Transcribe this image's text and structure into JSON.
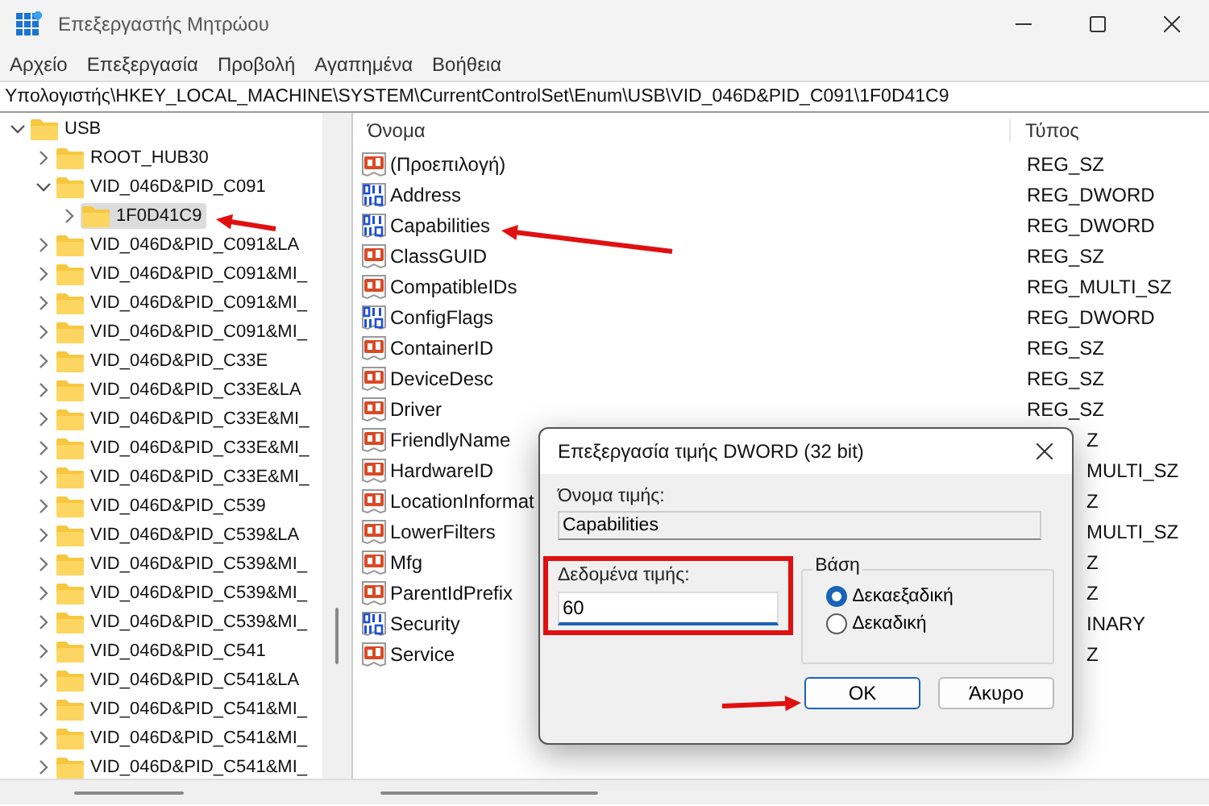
{
  "window": {
    "title": "Επεξεργαστής Μητρώου"
  },
  "menu": [
    {
      "label": "Αρχείο"
    },
    {
      "label": "Επεξεργασία"
    },
    {
      "label": "Προβολή"
    },
    {
      "label": "Αγαπημένα"
    },
    {
      "label": "Βοήθεια"
    }
  ],
  "address": "Υπολογιστής\\HKEY_LOCAL_MACHINE\\SYSTEM\\CurrentControlSet\\Enum\\USB\\VID_046D&PID_C091\\1F0D41C9",
  "tree": [
    {
      "label": "USB",
      "expanded": true,
      "selected": false,
      "children": [
        {
          "label": "ROOT_HUB30",
          "expanded": false,
          "selected": false
        },
        {
          "label": "VID_046D&PID_C091",
          "expanded": true,
          "selected": false,
          "children": [
            {
              "label": "1F0D41C9",
              "expanded": false,
              "selected": true
            }
          ]
        },
        {
          "label": "VID_046D&PID_C091&LA",
          "expanded": false,
          "selected": false
        },
        {
          "label": "VID_046D&PID_C091&MI_",
          "expanded": false,
          "selected": false
        },
        {
          "label": "VID_046D&PID_C091&MI_",
          "expanded": false,
          "selected": false
        },
        {
          "label": "VID_046D&PID_C091&MI_",
          "expanded": false,
          "selected": false
        },
        {
          "label": "VID_046D&PID_C33E",
          "expanded": false,
          "selected": false
        },
        {
          "label": "VID_046D&PID_C33E&LA",
          "expanded": false,
          "selected": false
        },
        {
          "label": "VID_046D&PID_C33E&MI_",
          "expanded": false,
          "selected": false
        },
        {
          "label": "VID_046D&PID_C33E&MI_",
          "expanded": false,
          "selected": false
        },
        {
          "label": "VID_046D&PID_C33E&MI_",
          "expanded": false,
          "selected": false
        },
        {
          "label": "VID_046D&PID_C539",
          "expanded": false,
          "selected": false
        },
        {
          "label": "VID_046D&PID_C539&LA",
          "expanded": false,
          "selected": false
        },
        {
          "label": "VID_046D&PID_C539&MI_",
          "expanded": false,
          "selected": false
        },
        {
          "label": "VID_046D&PID_C539&MI_",
          "expanded": false,
          "selected": false
        },
        {
          "label": "VID_046D&PID_C539&MI_",
          "expanded": false,
          "selected": false
        },
        {
          "label": "VID_046D&PID_C541",
          "expanded": false,
          "selected": false
        },
        {
          "label": "VID_046D&PID_C541&LA",
          "expanded": false,
          "selected": false
        },
        {
          "label": "VID_046D&PID_C541&MI_",
          "expanded": false,
          "selected": false
        },
        {
          "label": "VID_046D&PID_C541&MI_",
          "expanded": false,
          "selected": false
        },
        {
          "label": "VID_046D&PID_C541&MI_",
          "expanded": false,
          "selected": false
        }
      ]
    }
  ],
  "list": {
    "columns": [
      "Όνομα",
      "Τύπος"
    ],
    "rows": [
      {
        "name": "(Προεπιλογή)",
        "kind": "string",
        "type": "REG_SZ",
        "clipped": false
      },
      {
        "name": "Address",
        "kind": "binary",
        "type": "REG_DWORD",
        "clipped": false
      },
      {
        "name": "Capabilities",
        "kind": "binary",
        "type": "REG_DWORD",
        "clipped": false
      },
      {
        "name": "ClassGUID",
        "kind": "string",
        "type": "REG_SZ",
        "clipped": false
      },
      {
        "name": "CompatibleIDs",
        "kind": "string",
        "type": "REG_MULTI_SZ",
        "clipped": false
      },
      {
        "name": "ConfigFlags",
        "kind": "binary",
        "type": "REG_DWORD",
        "clipped": false
      },
      {
        "name": "ContainerID",
        "kind": "string",
        "type": "REG_SZ",
        "clipped": false
      },
      {
        "name": "DeviceDesc",
        "kind": "string",
        "type": "REG_SZ",
        "clipped": false
      },
      {
        "name": "Driver",
        "kind": "string",
        "type": "REG_SZ",
        "clipped": false
      },
      {
        "name": "FriendlyName",
        "kind": "string",
        "type": "Z",
        "clipped": true
      },
      {
        "name": "HardwareID",
        "kind": "string",
        "type": "MULTI_SZ",
        "clipped": true
      },
      {
        "name": "LocationInformat",
        "kind": "string",
        "type": "Z",
        "clipped": true
      },
      {
        "name": "LowerFilters",
        "kind": "string",
        "type": "MULTI_SZ",
        "clipped": true
      },
      {
        "name": "Mfg",
        "kind": "string",
        "type": "Z",
        "clipped": true
      },
      {
        "name": "ParentIdPrefix",
        "kind": "string",
        "type": "Z",
        "clipped": true
      },
      {
        "name": "Security",
        "kind": "binary",
        "type": "INARY",
        "clipped": true
      },
      {
        "name": "Service",
        "kind": "string",
        "type": "Z",
        "clipped": true
      }
    ]
  },
  "dialog": {
    "title": "Επεξεργασία τιμής DWORD (32 bit)",
    "name_label": "Όνομα τιμής:",
    "name_value": "Capabilities",
    "data_label": "Δεδομένα τιμής:",
    "data_value": "60",
    "base_label": "Βάση",
    "bases": [
      {
        "label": "Δεκαεξαδική",
        "selected": true
      },
      {
        "label": "Δεκαδική",
        "selected": false
      }
    ],
    "buttons": [
      {
        "label": "OK",
        "default": true
      },
      {
        "label": "Άκυρο",
        "default": false
      }
    ]
  }
}
